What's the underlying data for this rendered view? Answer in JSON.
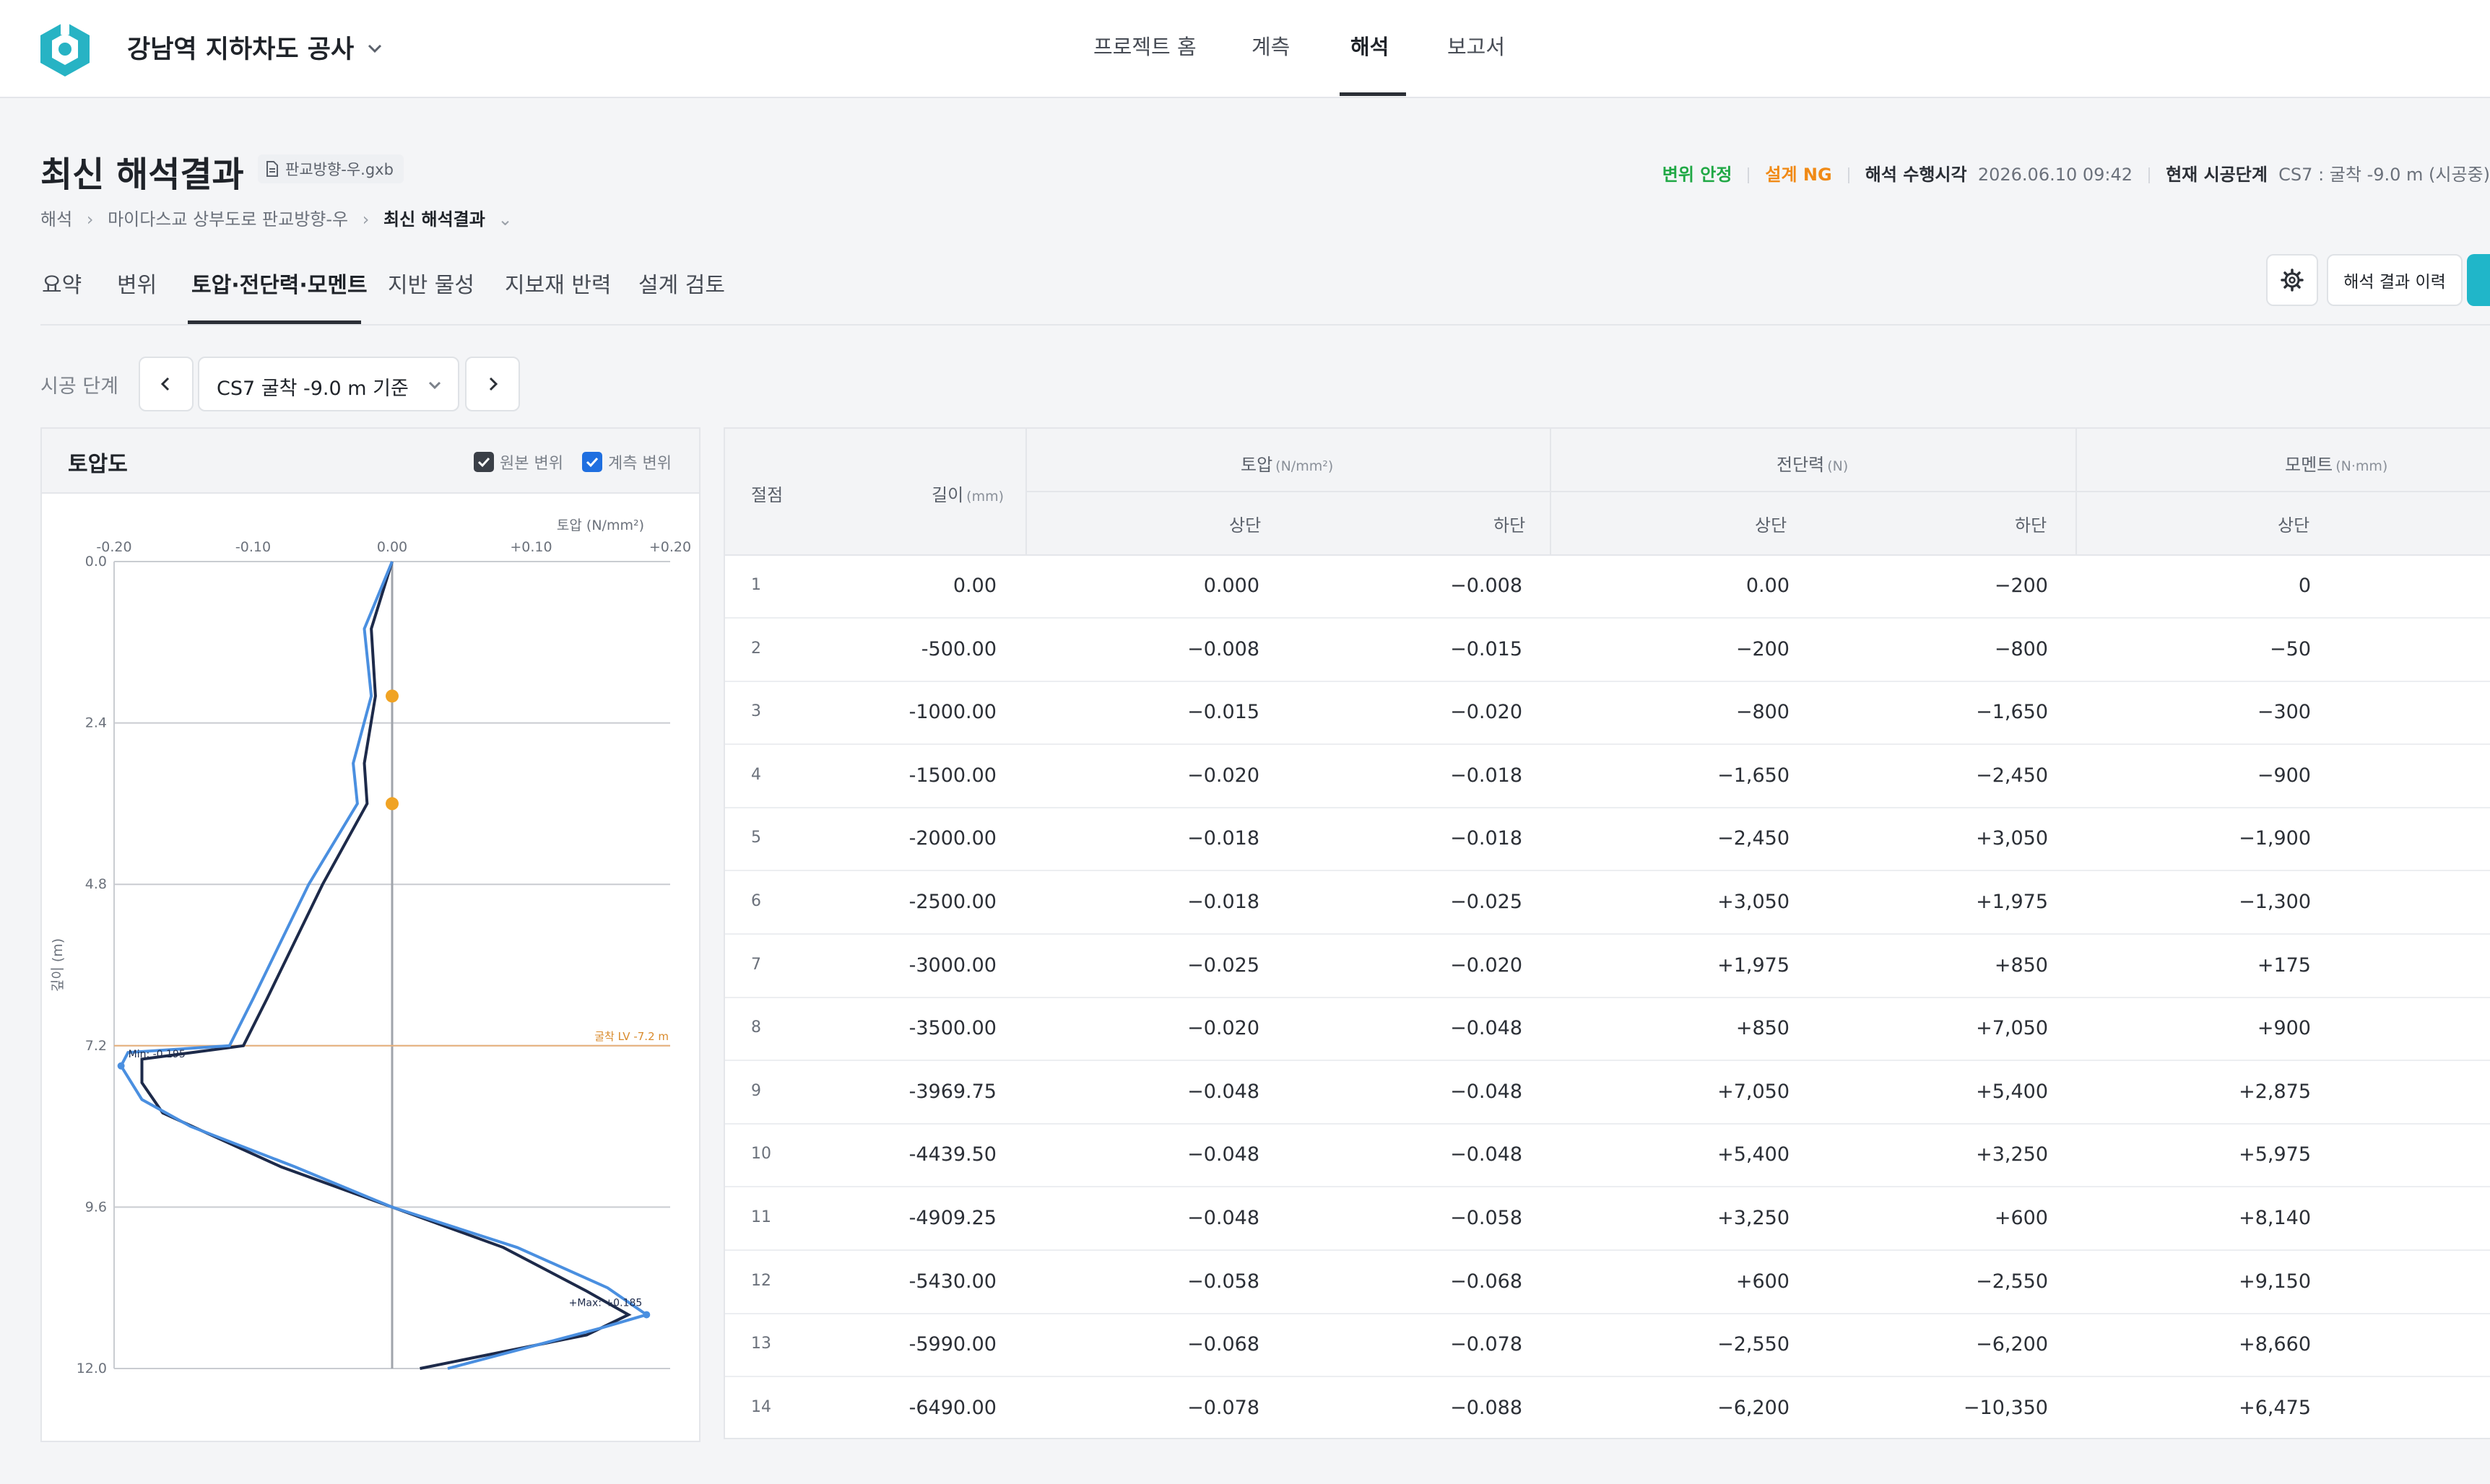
{
  "header": {
    "project_name": "강남역 지하차도 공사",
    "nav": [
      {
        "label": "프로젝트 홈"
      },
      {
        "label": "계측"
      },
      {
        "label": "해석"
      },
      {
        "label": "보고서"
      }
    ],
    "active_nav": "해석"
  },
  "page": {
    "title": "최신 해석결과",
    "file_chip": "판교방향-우.gxb",
    "breadcrumb": [
      "해석",
      "마이다스교 상부도로 판교방향-우",
      "최신 해석결과"
    ]
  },
  "status": {
    "displacement": "변위 안정",
    "design": "설계 NG",
    "analysis_time_label": "해석 수행시각",
    "analysis_time_value": "2026.06.10 09:42",
    "stage_label": "현재 시공단계",
    "stage_value": "CS7 : 굴착 -9.0 m (시공중)",
    "colors": {
      "ok": "#20a845",
      "ng": "#f08a16"
    }
  },
  "tabs": [
    {
      "label": "요약"
    },
    {
      "label": "변위"
    },
    {
      "label": "토압·전단력·모멘트"
    },
    {
      "label": "지반 물성"
    },
    {
      "label": "지보재 반력"
    },
    {
      "label": "설계 검토"
    }
  ],
  "active_tab": "토압·전단력·모멘트",
  "toolbar": {
    "history_label": "해석 결과 이력",
    "settings_icon": "gear-icon"
  },
  "stage": {
    "label": "시공 단계",
    "selected": "CS7 굴착 -9.0 m 기준"
  },
  "chart_panel": {
    "title": "토압도",
    "legend": [
      {
        "label": "원본 변위",
        "checked": true,
        "color": "#1d2a4a"
      },
      {
        "label": "계측 변위",
        "checked": true,
        "color": "#4a8fe0"
      }
    ]
  },
  "chart_data": {
    "type": "line",
    "xlabel": "토압 (N/mm²)",
    "ylabel": "깊이 (m)",
    "xlim": [
      -0.2,
      0.2
    ],
    "ylim": [
      0,
      12.0
    ],
    "x_ticks": [
      "-0.20",
      "-0.10",
      "0.00",
      "+0.10",
      "+0.20"
    ],
    "y_ticks": [
      "0.0",
      "2.4",
      "4.8",
      "7.2",
      "9.6",
      "12.0"
    ],
    "excavation_label": "굴착 LV -7.2 m",
    "excavation_depth": 7.2,
    "max_min_label": "Min: -0.195",
    "max_max_label": "+Max: +0.185",
    "series": [
      {
        "name": "원본 변위",
        "color": "#1d2a4a",
        "points": [
          [
            0.0,
            0.0
          ],
          [
            -0.015,
            1.0
          ],
          [
            -0.012,
            2.0
          ],
          [
            -0.02,
            3.0
          ],
          [
            -0.018,
            3.6
          ],
          [
            -0.05,
            4.8
          ],
          [
            -0.09,
            6.5
          ],
          [
            -0.107,
            7.2
          ],
          [
            -0.18,
            7.4
          ],
          [
            -0.18,
            7.75
          ],
          [
            -0.165,
            8.2
          ],
          [
            -0.08,
            9.0
          ],
          [
            0.0,
            9.6
          ],
          [
            0.08,
            10.2
          ],
          [
            0.14,
            10.85
          ],
          [
            0.17,
            11.2
          ],
          [
            0.14,
            11.5
          ],
          [
            0.02,
            12.0
          ]
        ]
      },
      {
        "name": "계측 변위",
        "color": "#4a8fe0",
        "points": [
          [
            0.0,
            0.0
          ],
          [
            -0.02,
            1.0
          ],
          [
            -0.015,
            2.0
          ],
          [
            -0.028,
            3.0
          ],
          [
            -0.025,
            3.6
          ],
          [
            -0.06,
            4.8
          ],
          [
            -0.1,
            6.5
          ],
          [
            -0.117,
            7.2
          ],
          [
            -0.19,
            7.3
          ],
          [
            -0.195,
            7.5
          ],
          [
            -0.18,
            8.0
          ],
          [
            -0.145,
            8.4
          ],
          [
            -0.07,
            9.0
          ],
          [
            0.0,
            9.6
          ],
          [
            0.09,
            10.2
          ],
          [
            0.155,
            10.8
          ],
          [
            0.183,
            11.2
          ],
          [
            0.15,
            11.4
          ],
          [
            0.04,
            12.0
          ]
        ]
      }
    ],
    "markers": [
      {
        "x": 0.0,
        "y": 2.0
      },
      {
        "x": 0.0,
        "y": 3.6
      }
    ]
  },
  "table": {
    "headers": {
      "node": "절점",
      "depth": "길이",
      "depth_unit": "(mm)",
      "groups": [
        {
          "label": "토압",
          "unit": "(N/mm²)"
        },
        {
          "label": "전단력",
          "unit": "(N)"
        },
        {
          "label": "모멘트",
          "unit": "(N·mm)"
        }
      ],
      "top": "상단",
      "bottom": "하단"
    },
    "rows": [
      [
        "1",
        "0.00",
        "0.000",
        "−0.008",
        "0.00",
        "−200",
        "0"
      ],
      [
        "2",
        "-500.00",
        "−0.008",
        "−0.015",
        "−200",
        "−800",
        "−50"
      ],
      [
        "3",
        "-1000.00",
        "−0.015",
        "−0.020",
        "−800",
        "−1,650",
        "−300"
      ],
      [
        "4",
        "-1500.00",
        "−0.020",
        "−0.018",
        "−1,650",
        "−2,450",
        "−900"
      ],
      [
        "5",
        "-2000.00",
        "−0.018",
        "−0.018",
        "−2,450",
        "+3,050",
        "−1,900"
      ],
      [
        "6",
        "-2500.00",
        "−0.018",
        "−0.025",
        "+3,050",
        "+1,975",
        "−1,300"
      ],
      [
        "7",
        "-3000.00",
        "−0.025",
        "−0.020",
        "+1,975",
        "+850",
        "+175"
      ],
      [
        "8",
        "-3500.00",
        "−0.020",
        "−0.048",
        "+850",
        "+7,050",
        "+900"
      ],
      [
        "9",
        "-3969.75",
        "−0.048",
        "−0.048",
        "+7,050",
        "+5,400",
        "+2,875"
      ],
      [
        "10",
        "-4439.50",
        "−0.048",
        "−0.048",
        "+5,400",
        "+3,250",
        "+5,975"
      ],
      [
        "11",
        "-4909.25",
        "−0.048",
        "−0.058",
        "+3,250",
        "+600",
        "+8,140"
      ],
      [
        "12",
        "-5430.00",
        "−0.058",
        "−0.068",
        "+600",
        "−2,550",
        "+9,150"
      ],
      [
        "13",
        "-5990.00",
        "−0.068",
        "−0.078",
        "−2,550",
        "−6,200",
        "+8,660"
      ],
      [
        "14",
        "-6490.00",
        "−0.078",
        "−0.088",
        "−6,200",
        "−10,350",
        "+6,475"
      ]
    ]
  }
}
